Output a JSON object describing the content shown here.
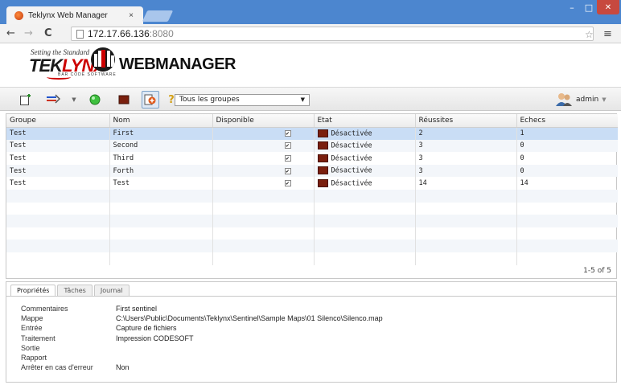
{
  "browser": {
    "tab_title": "Teklynx Web Manager",
    "tab_close": "×",
    "url_host": "172.17.66.136",
    "url_port": ":8080",
    "window_controls": {
      "minimize": "–",
      "maximize": "□",
      "close": "✕"
    }
  },
  "app": {
    "logo_tagline": "Setting the Standard",
    "logo_brand_a": "TEK",
    "logo_brand_b": "LYNX",
    "logo_sub": "BAR CODE SOFTWARE",
    "product_name": "WEBMANAGER"
  },
  "toolbar": {
    "group_filter": "Tous les groupes",
    "user": "admin",
    "icons": [
      "new-icon",
      "route-icon",
      "dropdown-icon",
      "start-icon",
      "stop-icon",
      "assign-icon",
      "help-icon"
    ]
  },
  "grid": {
    "columns": [
      "Groupe",
      "Nom",
      "Disponible",
      "Etat",
      "Réussites",
      "Echecs"
    ],
    "rows": [
      {
        "groupe": "Test",
        "nom": "First",
        "disponible": true,
        "etat": "Désactivée",
        "reussites": "2",
        "echecs": "1"
      },
      {
        "groupe": "Test",
        "nom": "Second",
        "disponible": true,
        "etat": "Désactivée",
        "reussites": "3",
        "echecs": "0"
      },
      {
        "groupe": "Test",
        "nom": "Third",
        "disponible": true,
        "etat": "Désactivée",
        "reussites": "3",
        "echecs": "0"
      },
      {
        "groupe": "Test",
        "nom": "Forth",
        "disponible": true,
        "etat": "Désactivée",
        "reussites": "3",
        "echecs": "0"
      },
      {
        "groupe": "Test",
        "nom": "Test",
        "disponible": true,
        "etat": "Désactivée",
        "reussites": "14",
        "echecs": "14"
      }
    ],
    "selected_row": 0,
    "pager": "1-5 of 5"
  },
  "panel": {
    "tabs": [
      "Propriétés",
      "Tâches",
      "Journal"
    ],
    "active_tab": 0,
    "properties": [
      {
        "label": "Commentaires",
        "value": "First sentinel"
      },
      {
        "label": "Mappe",
        "value": "C:\\Users\\Public\\Documents\\Teklynx\\Sentinel\\Sample Maps\\01 Silenco\\Silenco.map"
      },
      {
        "label": "Entrée",
        "value": "Capture de fichiers"
      },
      {
        "label": "Traitement",
        "value": "Impression CODESOFT"
      },
      {
        "label": "Sortie",
        "value": ""
      },
      {
        "label": "Rapport",
        "value": ""
      },
      {
        "label": "Arrêter en cas d'erreur",
        "value": "Non"
      }
    ]
  }
}
